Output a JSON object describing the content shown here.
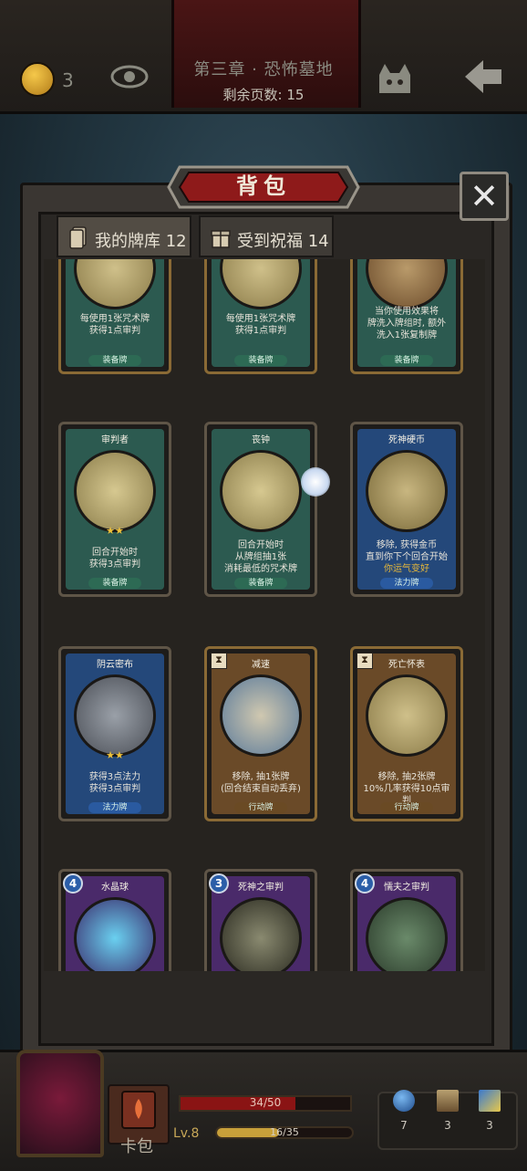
{
  "header": {
    "chapter_title": "第三章 · 恐怖墓地",
    "pages_left": "剩余页数: 15",
    "coins": "3"
  },
  "dialog": {
    "title": "背包",
    "close_label": "✕",
    "tabs": [
      {
        "label": "我的牌库 12"
      },
      {
        "label": "受到祝福 14"
      }
    ]
  },
  "cards": [
    {
      "name": "",
      "desc": [
        "每使用1张咒术牌",
        "获得1点审判"
      ],
      "tag": "装备牌"
    },
    {
      "name": "",
      "desc": [
        "每使用1张咒术牌",
        "获得1点审判"
      ],
      "tag": "装备牌"
    },
    {
      "name": "",
      "desc": [
        "当你使用效果将",
        "牌洗入牌组时, 额外",
        "洗入1张复制牌"
      ],
      "tag": "装备牌"
    },
    {
      "name": "审判者",
      "desc": [
        "回合开始时",
        "获得3点审判"
      ],
      "tag": "装备牌",
      "stars": "★★"
    },
    {
      "name": "丧钟",
      "desc": [
        "回合开始时",
        "从牌组抽1张",
        "消耗最低的咒术牌"
      ],
      "tag": "装备牌"
    },
    {
      "name": "死神硬币",
      "desc": [
        "移除, 获得金币",
        "直到你下个回合开始",
        "你运气变好"
      ],
      "tag": "法力牌"
    },
    {
      "name": "阴云密布",
      "desc": [
        "获得3点法力",
        "获得3点审判"
      ],
      "tag": "法力牌",
      "stars": "★★"
    },
    {
      "name": "减速",
      "desc": [
        "移除, 抽1张牌",
        "(回合结束自动丢弃)"
      ],
      "tag": "行动牌"
    },
    {
      "name": "死亡怀表",
      "desc": [
        "移除, 抽2张牌",
        "10%几率获得10点审判"
      ],
      "tag": "行动牌"
    },
    {
      "name": "水晶球",
      "cost": "4"
    },
    {
      "name": "死神之审判",
      "cost": "3"
    },
    {
      "name": "懦夫之审判",
      "cost": "4"
    }
  ],
  "player": {
    "deck_label": "卡包",
    "hp_text": "34/50",
    "hp_fraction": 0.68,
    "level": "Lv.8",
    "xp_text": "16/35",
    "xp_fraction": 0.457
  },
  "resources": [
    {
      "icon": "blue-orb-icon",
      "value": "7"
    },
    {
      "icon": "hourglass-icon",
      "value": "3"
    },
    {
      "icon": "cards-icon",
      "value": "3"
    }
  ]
}
